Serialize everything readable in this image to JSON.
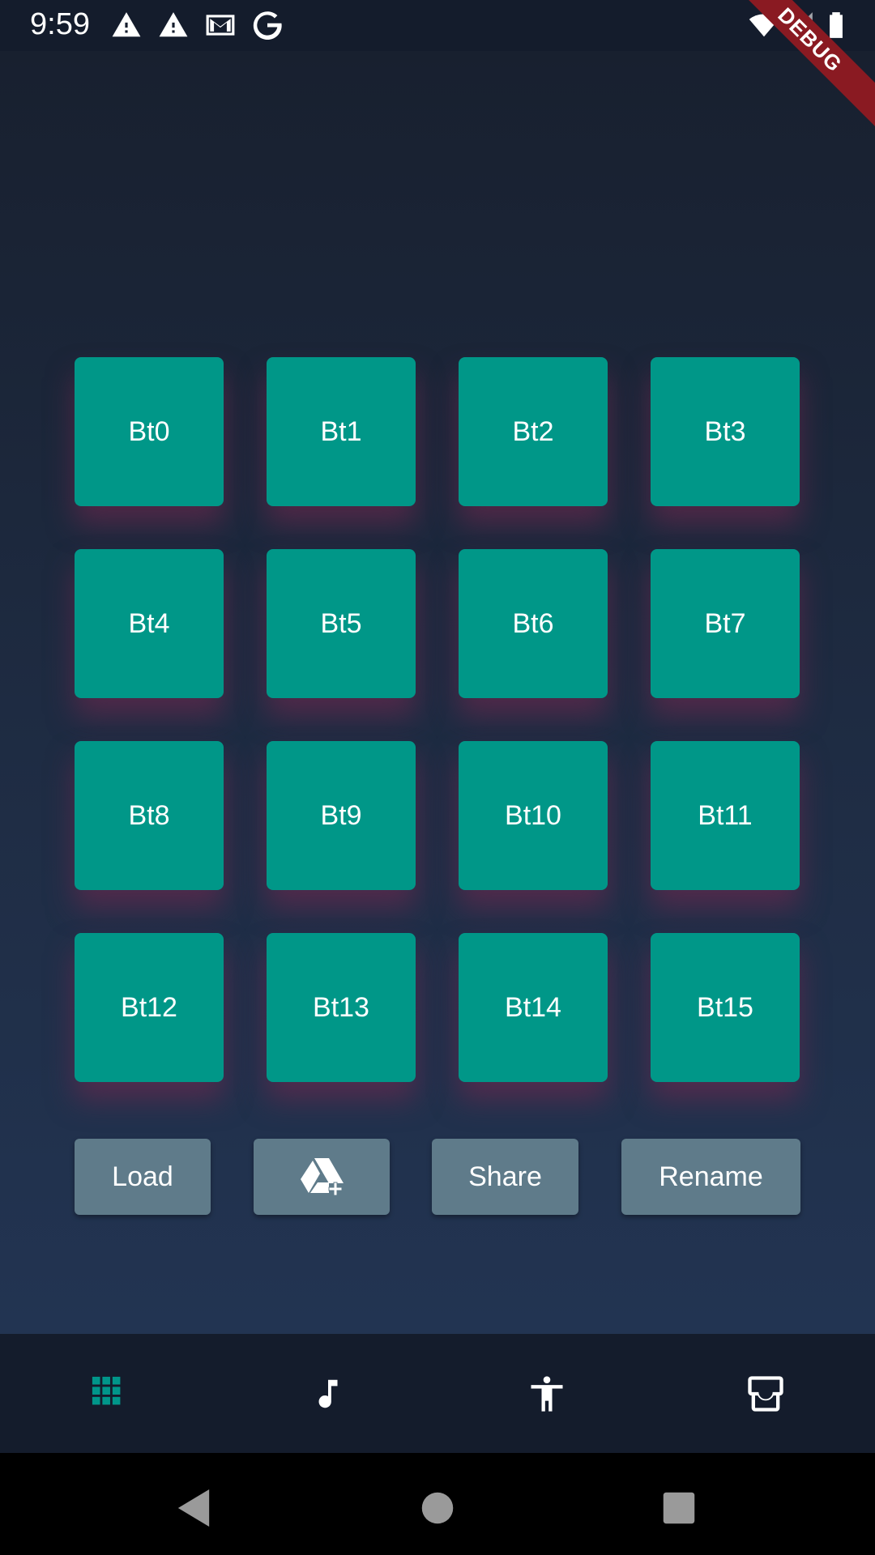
{
  "status_bar": {
    "time": "9:59",
    "icons": [
      "warning-icon",
      "warning-icon",
      "gmail-icon",
      "google-icon",
      "wifi-icon",
      "cell-signal-icon",
      "battery-icon"
    ]
  },
  "debug_banner": "DEBUG",
  "pads": [
    {
      "label": "Bt0"
    },
    {
      "label": "Bt1"
    },
    {
      "label": "Bt2"
    },
    {
      "label": "Bt3"
    },
    {
      "label": "Bt4"
    },
    {
      "label": "Bt5"
    },
    {
      "label": "Bt6"
    },
    {
      "label": "Bt7"
    },
    {
      "label": "Bt8"
    },
    {
      "label": "Bt9"
    },
    {
      "label": "Bt10"
    },
    {
      "label": "Bt11"
    },
    {
      "label": "Bt12"
    },
    {
      "label": "Bt13"
    },
    {
      "label": "Bt14"
    },
    {
      "label": "Bt15"
    }
  ],
  "actions": {
    "load_label": "Load",
    "drive_icon": "google-drive-add-icon",
    "share_label": "Share",
    "rename_label": "Rename"
  },
  "bottom_nav": {
    "items": [
      "grid-icon",
      "music-note-icon",
      "accessibility-icon",
      "inbox-icon"
    ],
    "active_color": "#00968a",
    "inactive_color": "#ffffff"
  },
  "colors": {
    "pad": "#009788",
    "action_button": "#5f7b8a",
    "background_top": "#18202f",
    "background_bottom": "#223452",
    "debug_banner": "#8a1a22"
  },
  "system_nav": {
    "items": [
      "back-icon",
      "home-icon",
      "recents-icon"
    ]
  }
}
